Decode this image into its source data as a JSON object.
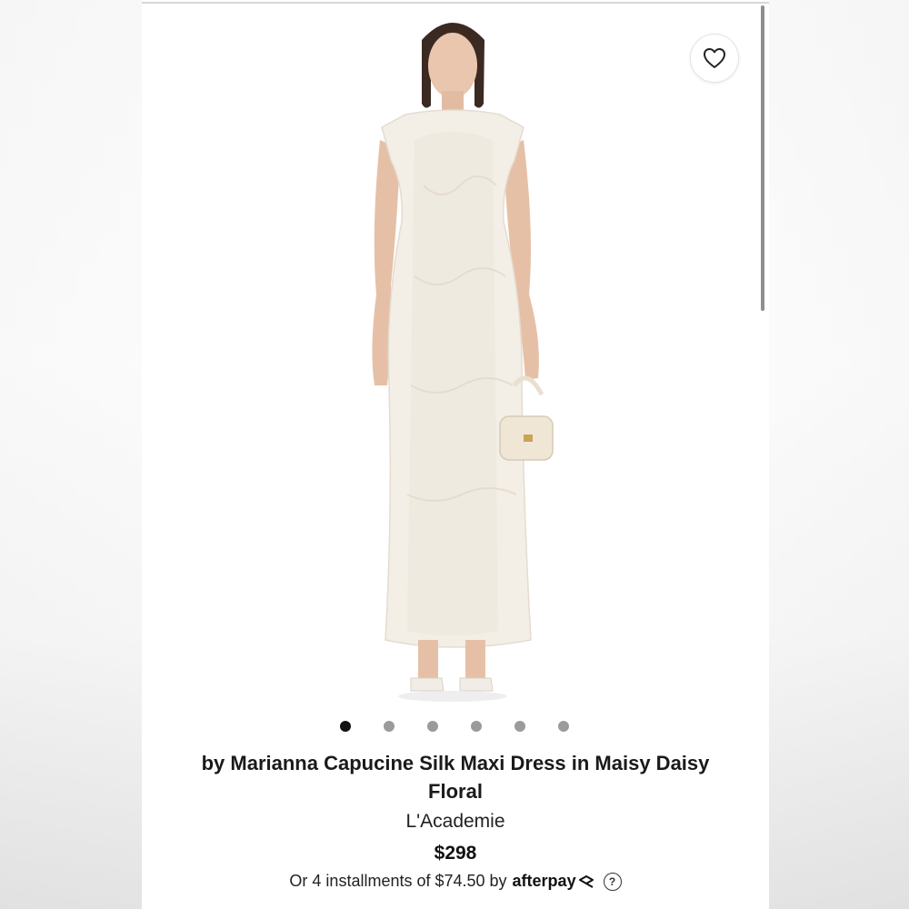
{
  "product": {
    "title": "by Marianna Capucine Silk Maxi Dress in Maisy Daisy Floral",
    "brand": "L'Academie",
    "price": "$298",
    "installments_prefix": "Or 4 installments of $74.50 by",
    "payment_provider": "afterpay",
    "help_symbol": "?"
  },
  "carousel": {
    "total_images": 6,
    "active_index": 0
  },
  "icons": {
    "wishlist": "heart-icon",
    "afterpay": "afterpay-arrows-icon",
    "help": "question-circle-icon"
  },
  "colors": {
    "dot_active": "#111111",
    "dot_inactive": "#9b9b9b",
    "dress": "#f3eee6"
  }
}
